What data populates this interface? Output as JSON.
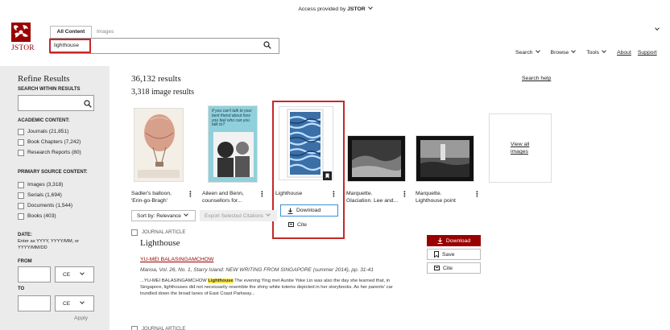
{
  "access_bar": {
    "text": "Access provided by ",
    "brand": "JSTOR"
  },
  "logo": {
    "text": "JSTOR"
  },
  "search_tabs": [
    {
      "label": "All Content",
      "active": true
    },
    {
      "label": "Images",
      "active": false
    }
  ],
  "search": {
    "value": "lighthouse"
  },
  "top_nav": {
    "search": "Search",
    "browse": "Browse",
    "tools": "Tools",
    "about": "About",
    "support": "Support"
  },
  "sidebar": {
    "title": "Refine Results",
    "within_label": "SEARCH WITHIN RESULTS",
    "academic_label": "ACADEMIC CONTENT:",
    "academic": [
      "Journals (21,851)",
      "Book Chapters (7,242)",
      "Research Reports (80)"
    ],
    "primary_label": "PRIMARY SOURCE CONTENT:",
    "primary": [
      "Images (3,318)",
      "Serials (1,694)",
      "Documents (1,544)",
      "Books (403)"
    ],
    "date_label": "DATE:",
    "date_hint": "Enter as YYYY, YYYY/MM, or YYYY/MM/DD",
    "from_label": "FROM",
    "to_label": "TO",
    "era": "CE",
    "apply": "Apply"
  },
  "results": {
    "count": "36,132 results",
    "image_count": "3,318 image results",
    "search_help": "Search help",
    "images": [
      {
        "caption1": "Sadler's balloon,",
        "caption2": "'Erin-go-Bragh'"
      },
      {
        "caption1": "Aileen and Benn,",
        "caption2": "counsellors for..."
      },
      {
        "caption1": "Lighthouse",
        "caption2": ""
      },
      {
        "caption1": "Marquette.",
        "caption2": "Glaciation. Lee and..."
      },
      {
        "caption1": "Marquette.",
        "caption2": "Lighthouse point"
      }
    ],
    "poster_text": "If you can't talk to your best friend about how you feel who can you talk to?",
    "view_all": {
      "line1": "View all",
      "line2": "images"
    },
    "image_menu": {
      "download": "Download",
      "cite": "Cite"
    },
    "sort": "Sort by: Relevance",
    "export": "Export Selected Citations",
    "article": {
      "type": "JOURNAL ARTICLE",
      "title": "Lighthouse",
      "author": "YU-MEI BALASINGAMCHOW",
      "source": "Manoa, Vol. 26, No. 1, Starry Island: NEW WRITING FROM SINGAPORE (summer 2014), pp. 31-41",
      "snippet_pre": "...YU-MEI BALASINGAMCHOW ",
      "snippet_hl": "Lighthouse",
      "snippet_post": " The evening Ying met Auntie Yoke Lin was also the day she learned that, in Singapore, lighthouses did not necessarily resemble the shiny white totems depicted in her storybooks. As her parents' car trundled down the broad lanes of East Coast Parkway...",
      "download": "Download",
      "save": "Save",
      "cite": "Cite"
    },
    "next_type": "JOURNAL ARTICLE"
  },
  "colors": {
    "accent": "#990000",
    "highlight": "#ffe84d",
    "redbox": "#c62828",
    "sidebar_bg": "#ebebeb"
  }
}
